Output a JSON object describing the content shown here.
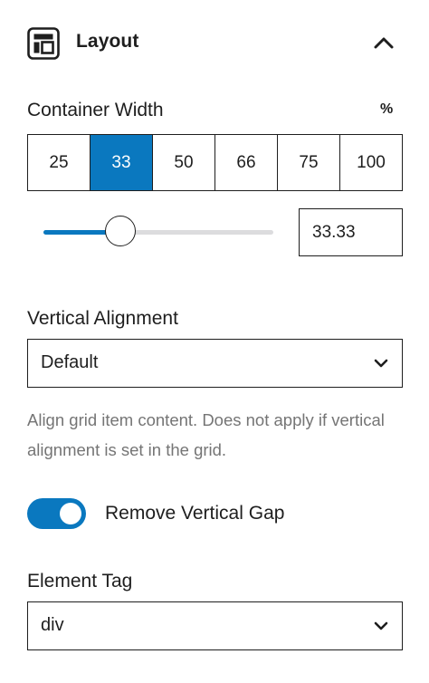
{
  "header": {
    "title": "Layout",
    "icon": "layout-icon",
    "collapse_icon": "chevron-up-icon"
  },
  "container_width": {
    "label": "Container Width",
    "unit": "%",
    "presets": [
      "25",
      "33",
      "50",
      "66",
      "75",
      "100"
    ],
    "selected_preset": "33",
    "value": "33.33",
    "slider_fraction": 0.3333
  },
  "vertical_alignment": {
    "label": "Vertical Alignment",
    "value": "Default",
    "help": "Align grid item content. Does not apply if vertical alignment is set in the grid."
  },
  "remove_vertical_gap": {
    "label": "Remove Vertical Gap",
    "checked": true
  },
  "element_tag": {
    "label": "Element Tag",
    "value": "div"
  },
  "colors": {
    "accent": "#0a78bf",
    "text": "#1e1e1e",
    "help_text": "#757575",
    "track": "#dcdcde"
  }
}
